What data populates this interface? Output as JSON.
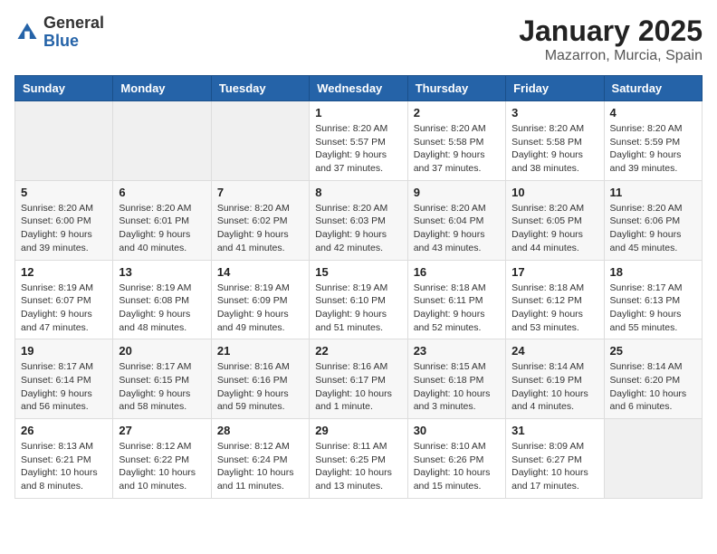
{
  "logo": {
    "general": "General",
    "blue": "Blue"
  },
  "header": {
    "month": "January 2025",
    "location": "Mazarron, Murcia, Spain"
  },
  "weekdays": [
    "Sunday",
    "Monday",
    "Tuesday",
    "Wednesday",
    "Thursday",
    "Friday",
    "Saturday"
  ],
  "weeks": [
    [
      {
        "day": "",
        "info": ""
      },
      {
        "day": "",
        "info": ""
      },
      {
        "day": "",
        "info": ""
      },
      {
        "day": "1",
        "info": "Sunrise: 8:20 AM\nSunset: 5:57 PM\nDaylight: 9 hours and 37 minutes."
      },
      {
        "day": "2",
        "info": "Sunrise: 8:20 AM\nSunset: 5:58 PM\nDaylight: 9 hours and 37 minutes."
      },
      {
        "day": "3",
        "info": "Sunrise: 8:20 AM\nSunset: 5:58 PM\nDaylight: 9 hours and 38 minutes."
      },
      {
        "day": "4",
        "info": "Sunrise: 8:20 AM\nSunset: 5:59 PM\nDaylight: 9 hours and 39 minutes."
      }
    ],
    [
      {
        "day": "5",
        "info": "Sunrise: 8:20 AM\nSunset: 6:00 PM\nDaylight: 9 hours and 39 minutes."
      },
      {
        "day": "6",
        "info": "Sunrise: 8:20 AM\nSunset: 6:01 PM\nDaylight: 9 hours and 40 minutes."
      },
      {
        "day": "7",
        "info": "Sunrise: 8:20 AM\nSunset: 6:02 PM\nDaylight: 9 hours and 41 minutes."
      },
      {
        "day": "8",
        "info": "Sunrise: 8:20 AM\nSunset: 6:03 PM\nDaylight: 9 hours and 42 minutes."
      },
      {
        "day": "9",
        "info": "Sunrise: 8:20 AM\nSunset: 6:04 PM\nDaylight: 9 hours and 43 minutes."
      },
      {
        "day": "10",
        "info": "Sunrise: 8:20 AM\nSunset: 6:05 PM\nDaylight: 9 hours and 44 minutes."
      },
      {
        "day": "11",
        "info": "Sunrise: 8:20 AM\nSunset: 6:06 PM\nDaylight: 9 hours and 45 minutes."
      }
    ],
    [
      {
        "day": "12",
        "info": "Sunrise: 8:19 AM\nSunset: 6:07 PM\nDaylight: 9 hours and 47 minutes."
      },
      {
        "day": "13",
        "info": "Sunrise: 8:19 AM\nSunset: 6:08 PM\nDaylight: 9 hours and 48 minutes."
      },
      {
        "day": "14",
        "info": "Sunrise: 8:19 AM\nSunset: 6:09 PM\nDaylight: 9 hours and 49 minutes."
      },
      {
        "day": "15",
        "info": "Sunrise: 8:19 AM\nSunset: 6:10 PM\nDaylight: 9 hours and 51 minutes."
      },
      {
        "day": "16",
        "info": "Sunrise: 8:18 AM\nSunset: 6:11 PM\nDaylight: 9 hours and 52 minutes."
      },
      {
        "day": "17",
        "info": "Sunrise: 8:18 AM\nSunset: 6:12 PM\nDaylight: 9 hours and 53 minutes."
      },
      {
        "day": "18",
        "info": "Sunrise: 8:17 AM\nSunset: 6:13 PM\nDaylight: 9 hours and 55 minutes."
      }
    ],
    [
      {
        "day": "19",
        "info": "Sunrise: 8:17 AM\nSunset: 6:14 PM\nDaylight: 9 hours and 56 minutes."
      },
      {
        "day": "20",
        "info": "Sunrise: 8:17 AM\nSunset: 6:15 PM\nDaylight: 9 hours and 58 minutes."
      },
      {
        "day": "21",
        "info": "Sunrise: 8:16 AM\nSunset: 6:16 PM\nDaylight: 9 hours and 59 minutes."
      },
      {
        "day": "22",
        "info": "Sunrise: 8:16 AM\nSunset: 6:17 PM\nDaylight: 10 hours and 1 minute."
      },
      {
        "day": "23",
        "info": "Sunrise: 8:15 AM\nSunset: 6:18 PM\nDaylight: 10 hours and 3 minutes."
      },
      {
        "day": "24",
        "info": "Sunrise: 8:14 AM\nSunset: 6:19 PM\nDaylight: 10 hours and 4 minutes."
      },
      {
        "day": "25",
        "info": "Sunrise: 8:14 AM\nSunset: 6:20 PM\nDaylight: 10 hours and 6 minutes."
      }
    ],
    [
      {
        "day": "26",
        "info": "Sunrise: 8:13 AM\nSunset: 6:21 PM\nDaylight: 10 hours and 8 minutes."
      },
      {
        "day": "27",
        "info": "Sunrise: 8:12 AM\nSunset: 6:22 PM\nDaylight: 10 hours and 10 minutes."
      },
      {
        "day": "28",
        "info": "Sunrise: 8:12 AM\nSunset: 6:24 PM\nDaylight: 10 hours and 11 minutes."
      },
      {
        "day": "29",
        "info": "Sunrise: 8:11 AM\nSunset: 6:25 PM\nDaylight: 10 hours and 13 minutes."
      },
      {
        "day": "30",
        "info": "Sunrise: 8:10 AM\nSunset: 6:26 PM\nDaylight: 10 hours and 15 minutes."
      },
      {
        "day": "31",
        "info": "Sunrise: 8:09 AM\nSunset: 6:27 PM\nDaylight: 10 hours and 17 minutes."
      },
      {
        "day": "",
        "info": ""
      }
    ]
  ]
}
